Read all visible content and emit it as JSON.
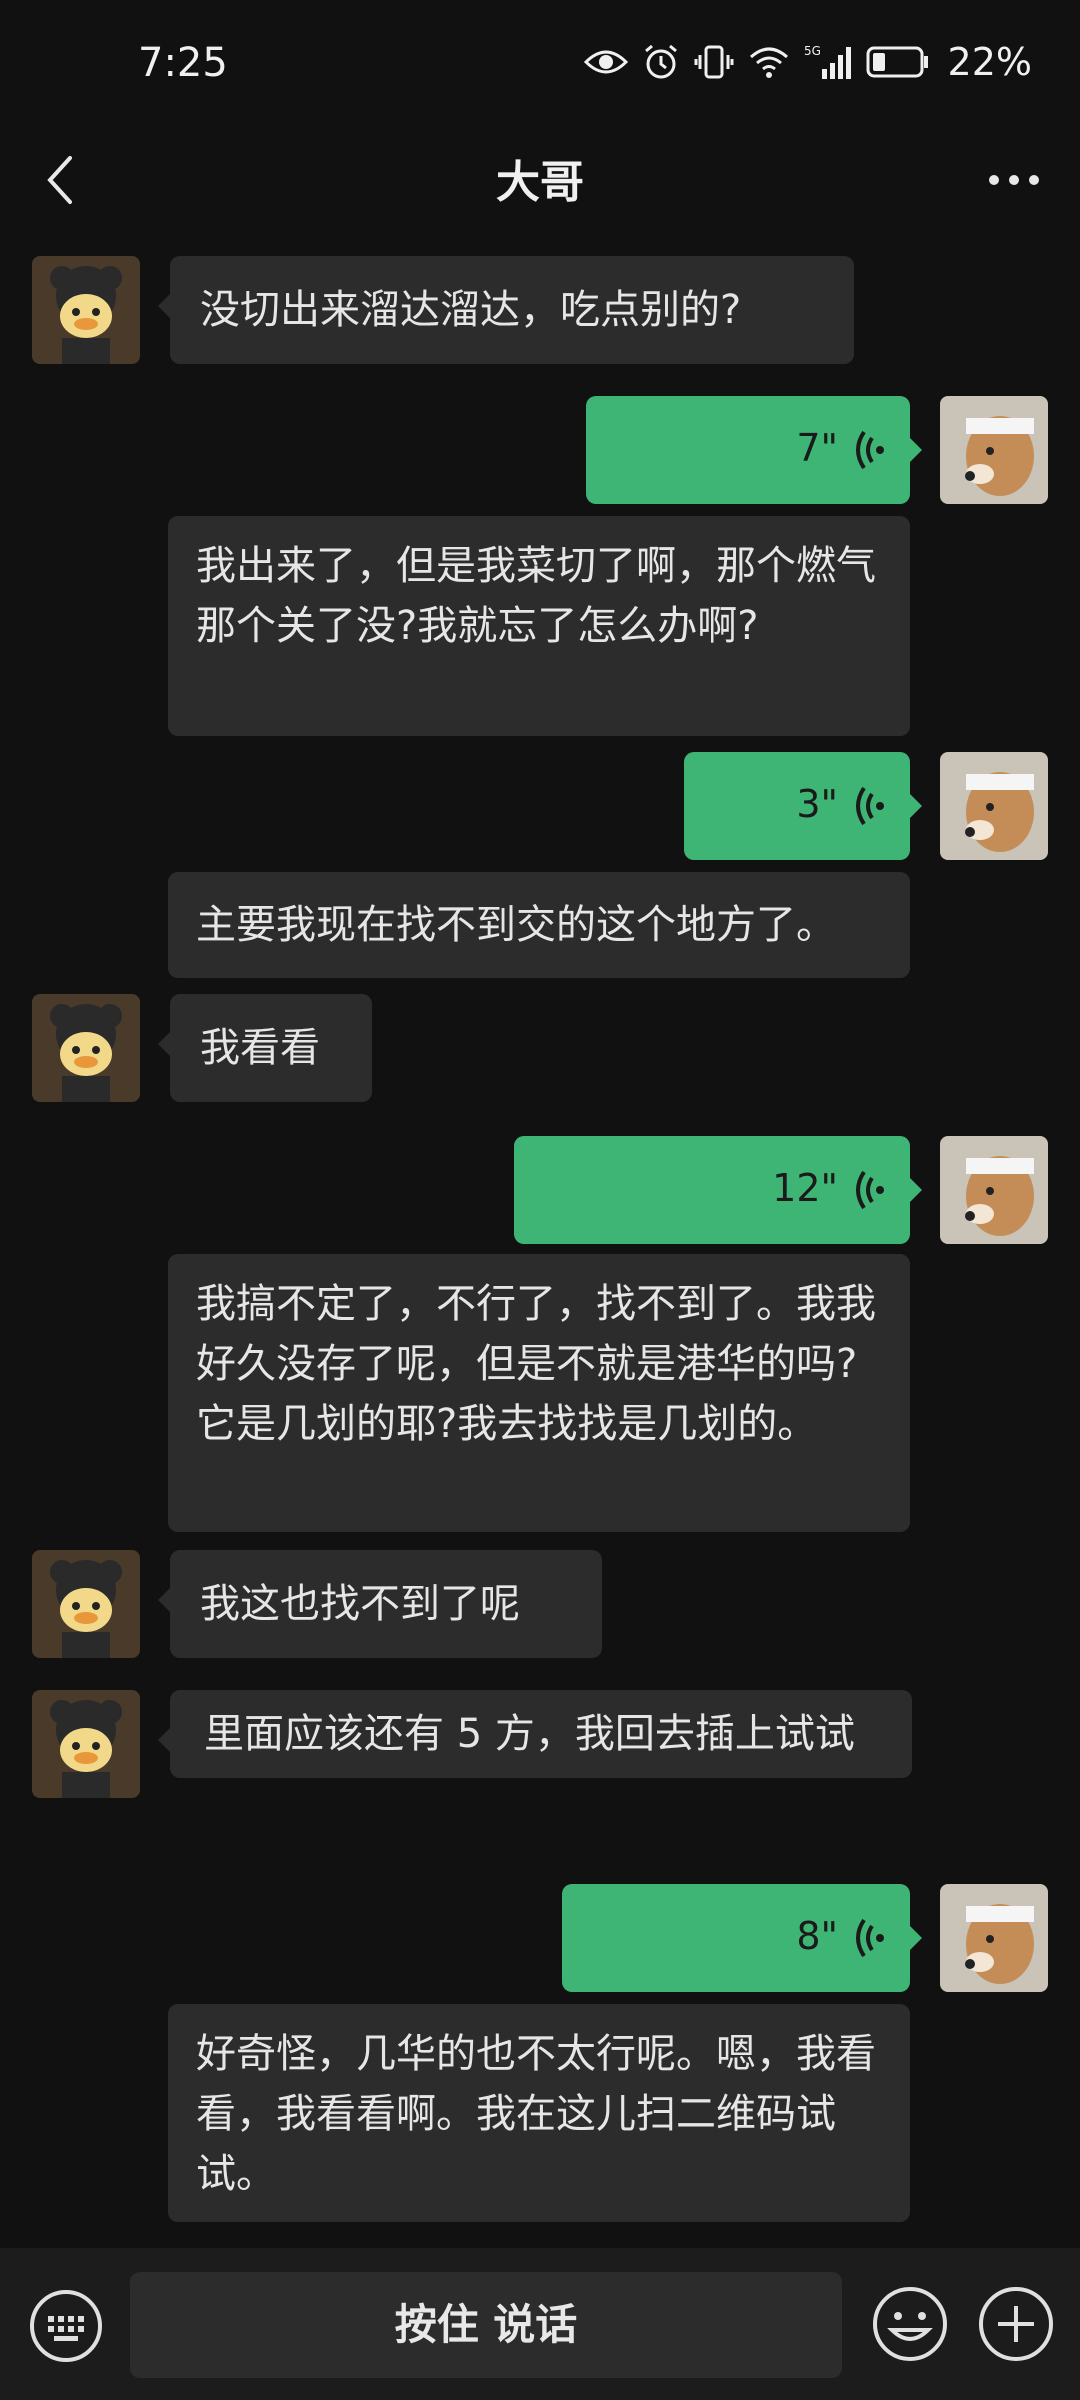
{
  "status_bar": {
    "time": "7:25",
    "battery": "22%",
    "network": "5G"
  },
  "header": {
    "title": "大哥"
  },
  "messages": {
    "m1": {
      "text": "没切出来溜达溜达，吃点别的?"
    },
    "m2": {
      "duration": "7\"",
      "transcript": "我出来了，但是我菜切了啊，那个燃气那个关了没?我就忘了怎么办啊?"
    },
    "m3": {
      "duration": "3\"",
      "transcript": "主要我现在找不到交的这个地方了。"
    },
    "m4": {
      "text": "我看看"
    },
    "m5": {
      "duration": "12\"",
      "transcript": "我搞不定了，不行了，找不到了。我我好久没存了呢，但是不就是港华的吗?它是几划的耶?我去找找是几划的。"
    },
    "m6": {
      "text": "我这也找不到了呢"
    },
    "m7": {
      "text": "里面应该还有 5 方，我回去插上试试"
    },
    "m8": {
      "duration": "8\"",
      "transcript": "好奇怪，几华的也不太行呢。嗯，我看看，我看看啊。我在这儿扫二维码试试。"
    }
  },
  "bottom_bar": {
    "press_to_talk": "按住 说话"
  },
  "colors": {
    "voice_bubble": "#3eb575",
    "bubble": "#2c2c2c",
    "background": "#111111"
  },
  "icons": [
    "back-icon",
    "more-icon",
    "voice-wave-icon",
    "keyboard-icon",
    "emoji-icon",
    "plus-icon"
  ]
}
